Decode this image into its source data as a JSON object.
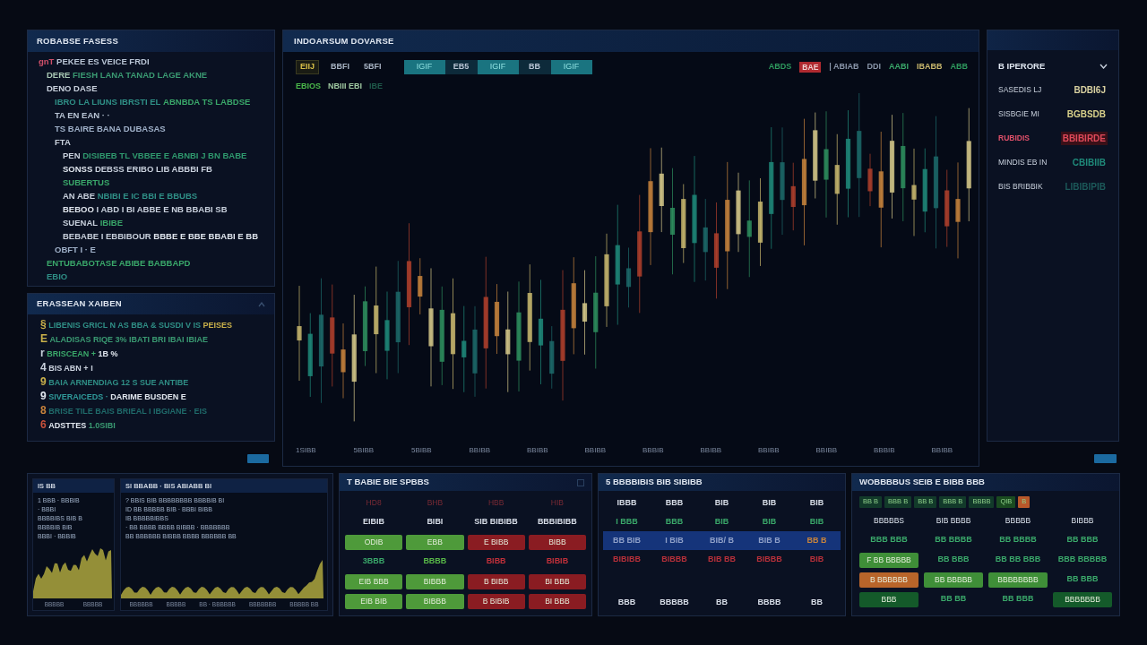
{
  "outline_panel": {
    "title": "ROBABSE FASESS",
    "lines": [
      {
        "segments": [
          {
            "text": "gnT",
            "color": "#d0506a"
          },
          {
            "text": "PEKEE ES VEICE FRDI",
            "color": "#b8c4d4"
          }
        ],
        "children": [
          {
            "segments": [
              {
                "text": "DERE",
                "color": "#a8c8b4"
              },
              {
                "text": "FIESH LANA TANAD LAGE AKNE",
                "color": "#3a9a72"
              }
            ]
          },
          {
            "segments": [
              {
                "text": "DENO DASE",
                "color": "#c8d0dc"
              }
            ],
            "children": [
              {
                "segments": [
                  {
                    "text": "IBRO LA LIUNS IBRSTI EL",
                    "color": "#2f8f86"
                  },
                  {
                    "text": "ABNBDA TS LABDSE",
                    "color": "#3aa86a"
                  }
                ]
              },
              {
                "segments": [
                  {
                    "text": "TA EN EAN · ·",
                    "color": "#b8c4d4"
                  }
                ]
              },
              {
                "segments": [
                  {
                    "text": "TS BAIRE BANA DUBASAS",
                    "color": "#9fb0c8"
                  }
                ]
              },
              {
                "segments": [
                  {
                    "text": "FTA",
                    "color": "#c8d0dc"
                  }
                ],
                "children": [
                  {
                    "segments": [
                      {
                        "text": "PEN",
                        "color": "#c8d0dc"
                      },
                      {
                        "text": "DISIBEB TL VBBEE E ABNBI J BN BABE",
                        "color": "#2f9a6e"
                      }
                    ]
                  },
                  {
                    "segments": [
                      {
                        "text": "SONSS",
                        "color": "#e0e6ee"
                      },
                      {
                        "text": "DEBSS ERIBO LIB ABBBI FB",
                        "color": "#c8d0dc"
                      }
                    ]
                  },
                  {
                    "segments": [
                      {
                        "text": "SUBERTUS",
                        "color": "#3aa86a"
                      }
                    ]
                  },
                  {
                    "segments": [
                      {
                        "text": "AN ABE",
                        "color": "#c8d0dc"
                      },
                      {
                        "text": "NBIBI E IC BBI E BBUBS",
                        "color": "#2f8f86"
                      }
                    ]
                  },
                  {
                    "segments": [
                      {
                        "text": "BEBOO",
                        "color": "#e0e6ee"
                      },
                      {
                        "text": "I ABD I BI ABBE E NB BBABI SB",
                        "color": "#c8d0dc"
                      }
                    ]
                  },
                  {
                    "segments": [
                      {
                        "text": "SUENAL",
                        "color": "#c8d0dc"
                      },
                      {
                        "text": "IBIBE",
                        "color": "#3aa86a"
                      }
                    ]
                  },
                  {
                    "segments": [
                      {
                        "text": "BEBABE I EBBIBOUR",
                        "color": "#c8d0dc"
                      },
                      {
                        "text": "BBBE E BBE BBABI E BB",
                        "color": "#e0e6ee"
                      }
                    ]
                  }
                ]
              },
              {
                "segments": [
                  {
                    "text": "OBFT I · E",
                    "color": "#9fb0c8"
                  }
                ]
              }
            ]
          },
          {
            "segments": [
              {
                "text": "ENTUBABOTASE ABIBE BABBAPD",
                "color": "#3aa86a"
              }
            ]
          },
          {
            "segments": [
              {
                "text": "EBIO",
                "color": "#2f8f86"
              }
            ]
          }
        ]
      }
    ]
  },
  "notes_panel": {
    "title": "ERASSEAN XAIBEN",
    "lines": [
      {
        "segments": [
          {
            "text": "§",
            "color": "#c9b04a"
          },
          {
            "text": "LIBENIS GRICL N AS BBA & SUSDI V IS",
            "color": "#2f8f86"
          },
          {
            "text": "PEISES",
            "color": "#c9b04a"
          }
        ]
      },
      {
        "segments": [
          {
            "text": "E",
            "color": "#c9b04a"
          },
          {
            "text": "ALADISAS RIQE 3% IBATI BRI IBAI IBIAE",
            "color": "#3a9a72"
          }
        ]
      },
      {
        "segments": [
          {
            "text": "r",
            "color": "#c8d0dc"
          },
          {
            "text": "BRISCEAN +",
            "color": "#3aa86a"
          },
          {
            "text": "1B %",
            "color": "#e0e6ee"
          }
        ]
      },
      {
        "segments": [
          {
            "text": "4",
            "color": "#c8d0dc"
          },
          {
            "text": "BIS ABN + I",
            "color": "#c8d0dc"
          }
        ]
      },
      {
        "segments": [
          {
            "text": "9",
            "color": "#c9b04a"
          },
          {
            "text": "BAIA ARNENDIAG 12 S SUE ANTIBE",
            "color": "#2f8f86"
          }
        ]
      },
      {
        "segments": [
          {
            "text": "9",
            "color": "#e0e6ee"
          },
          {
            "text": "SIVERAICEDS ·",
            "color": "#2f9a9a"
          },
          {
            "text": "DARIME BUSDEN E",
            "color": "#e0e6ee"
          }
        ]
      },
      {
        "segments": [
          {
            "text": "8",
            "color": "#c9843c"
          },
          {
            "text": "BRISE TILE BAIS BRIEAL I IBGIANE · EIS",
            "color": "#1f6a6a"
          }
        ]
      },
      {
        "segments": [
          {
            "text": "6",
            "color": "#c8503a"
          },
          {
            "text": "ADSTTES",
            "color": "#e0e6ee"
          },
          {
            "text": "1.0SIBI",
            "color": "#3a9a72"
          }
        ]
      }
    ]
  },
  "chart_panel": {
    "title": "INDOARSUM DOVARSE",
    "tools": [
      {
        "label": "EIIJ",
        "selected": true
      },
      {
        "label": "BBFI",
        "selected": false
      },
      {
        "label": "5BFI",
        "selected": false
      }
    ],
    "timeframes": [
      {
        "label": "IGIF",
        "selected": true
      },
      {
        "label": "EB5",
        "selected": false
      },
      {
        "label": "IGIF",
        "selected": true
      },
      {
        "label": "BB",
        "selected": false
      },
      {
        "label": "IGIF",
        "selected": true
      }
    ],
    "legend": [
      {
        "text": "ABDS",
        "color": "#2e9a5e",
        "kind": "text"
      },
      {
        "text": "BAE",
        "color": "#b02a30",
        "kind": "badge"
      },
      {
        "text": "| ABIAB",
        "color": "#8a96aa",
        "kind": "text"
      },
      {
        "text": "DDI",
        "color": "#8a96aa",
        "kind": "text"
      },
      {
        "text": "AABI",
        "color": "#3aa86a",
        "kind": "text"
      },
      {
        "text": "IBABB",
        "color": "#c9b86e",
        "kind": "text"
      },
      {
        "text": "ABB",
        "color": "#2e9a5e",
        "kind": "text"
      }
    ],
    "readouts": [
      {
        "text": "EBIOS",
        "color": "#4ab84a"
      },
      {
        "text": "NBIII EBI",
        "color": "#9fc8a0"
      },
      {
        "text": "IBE",
        "color": "#1f5a4a"
      }
    ],
    "x_labels": [
      "1SIBB",
      "5BIBB",
      "5BIBB",
      "BBIBB",
      "BBIBB",
      "BBIBB",
      "BBBIB",
      "BBIBB",
      "BBIBB",
      "BBIBB",
      "BBBIB",
      "BBIBB"
    ]
  },
  "watchlist": {
    "title": "B IPERORE",
    "rows": [
      {
        "name": "SASEDIS LJ",
        "value": "BDBI6J",
        "color": "#d8d0a0",
        "alert": false
      },
      {
        "name": "SISBGIE MI",
        "value": "BGBSDB",
        "color": "#d8d08a",
        "alert": false
      },
      {
        "name": "RUBIDIS",
        "value": "BBIBIRDE",
        "color": "#e04a5a",
        "alert": true
      },
      {
        "name": "MINDIS EB IN",
        "value": "CBIBIIB",
        "color": "#1f8a7a",
        "alert": false
      },
      {
        "name": "BIS BRIBBIK",
        "value": "LIBIBIPIB",
        "color": "#1c5a5a",
        "alert": false
      }
    ]
  },
  "mini_charts": [
    {
      "title": "IS BB",
      "lines": [
        "1 BBB · BBBIB",
        "· BBBI",
        "BBBBIBS BIB B",
        "BBBBIB BIB",
        "BBBI · BBBIB"
      ],
      "x_labels": [
        "BBBBB",
        "BBBBB"
      ]
    },
    {
      "title": "SI BBABB · BIS ABIABB BI",
      "lines": [
        "? BBIS BIB BBBBBBBB BBBBIB BI",
        "ID BB BBBBB BIB · BBBI BIBB",
        "IB BBBBBIBBS",
        "· BB BBBB BBBB BIBBB · BBBBBBB",
        "BB BBBBBB BIBBB BBBB BBBBBB BB"
      ],
      "x_labels": [
        "BBBBBB",
        "BBBBB",
        "BB · BBBBBB",
        "BBBBBBB",
        "BBBBB BB"
      ]
    }
  ],
  "quotes_table": {
    "title": "T BABIE BIE SPBBS",
    "header": [
      "HD8",
      "BHB",
      "HBB",
      "HIB"
    ],
    "rows": [
      [
        {
          "text": "EIBIB",
          "color": "#d8dee8",
          "kind": "text"
        },
        {
          "text": "BIBI",
          "color": "#d8dee8",
          "kind": "text"
        },
        {
          "text": "SIB BIBIBB",
          "color": "#d8dee8",
          "kind": "text"
        },
        {
          "text": "BBBIBIBB",
          "color": "#d8dee8",
          "kind": "text"
        }
      ],
      [
        {
          "text": "ODIB",
          "color": "#4e9a3a",
          "kind": "filled"
        },
        {
          "text": "EBB",
          "color": "#4e9a3a",
          "kind": "filled"
        },
        {
          "text": "E BIBB",
          "color": "#8a1c22",
          "kind": "filled"
        },
        {
          "text": "BIBB",
          "color": "#8a1c22",
          "kind": "filled"
        }
      ],
      [
        {
          "text": "3BBB",
          "color": "#3aa86a",
          "kind": "text"
        },
        {
          "text": "BBBB",
          "color": "#58b848",
          "kind": "text"
        },
        {
          "text": "BIBB",
          "color": "#c0303a",
          "kind": "text"
        },
        {
          "text": "BIBIB",
          "color": "#c0303a",
          "kind": "text"
        }
      ],
      [
        {
          "text": "EIB BBB",
          "color": "#4e9a3a",
          "kind": "filled"
        },
        {
          "text": "BIBBB",
          "color": "#4e9a3a",
          "kind": "filled"
        },
        {
          "text": "B BIBB",
          "color": "#8a1c22",
          "kind": "filled"
        },
        {
          "text": "BI BBB",
          "color": "#8a1c22",
          "kind": "filled"
        }
      ],
      [
        {
          "text": "EIB BIB",
          "color": "#4e9a3a",
          "kind": "filled"
        },
        {
          "text": "BIBBB",
          "color": "#4e9a3a",
          "kind": "filled"
        },
        {
          "text": "B BIBIB",
          "color": "#8a1c22",
          "kind": "filled"
        },
        {
          "text": "BI BBB",
          "color": "#8a1c22",
          "kind": "filled"
        }
      ]
    ]
  },
  "trades_table": {
    "title": "5 BBBBIBIS BIB SIBIBB",
    "rows": [
      {
        "selected": false,
        "cells": [
          {
            "text": "IBBB",
            "color": "#d8dee8"
          },
          {
            "text": "BBB",
            "color": "#d8dee8"
          },
          {
            "text": "BIB",
            "color": "#d8dee8"
          },
          {
            "text": "BIB",
            "color": "#d8dee8"
          },
          {
            "text": "BIB",
            "color": "#d8dee8"
          }
        ]
      },
      {
        "selected": false,
        "cells": [
          {
            "text": "I BBB",
            "color": "#3aa86a"
          },
          {
            "text": "BBB",
            "color": "#3aa86a"
          },
          {
            "text": "BIB",
            "color": "#3aa86a"
          },
          {
            "text": "BIB",
            "color": "#3aa86a"
          },
          {
            "text": "BIB",
            "color": "#3aa86a"
          }
        ]
      },
      {
        "selected": true,
        "cells": [
          {
            "text": "BB BIB",
            "color": "#8fa0c8"
          },
          {
            "text": "I BIB",
            "color": "#8fa0c8"
          },
          {
            "text": "BIB/ B",
            "color": "#8fa0c8"
          },
          {
            "text": "BIB B",
            "color": "#8fa0c8"
          },
          {
            "text": "BB B",
            "color": "#c8843c"
          }
        ]
      },
      {
        "selected": false,
        "cells": [
          {
            "text": "BIBIBB",
            "color": "#b8303a"
          },
          {
            "text": "BIBBB",
            "color": "#b8303a"
          },
          {
            "text": "BIB BB",
            "color": "#b8303a"
          },
          {
            "text": "BIBBB",
            "color": "#b8303a"
          },
          {
            "text": "BIB",
            "color": "#b8303a"
          }
        ]
      },
      {
        "selected": false,
        "cells": [
          {
            "text": "BBB",
            "color": "#d8dee8"
          },
          {
            "text": "BBBBB",
            "color": "#d8dee8"
          },
          {
            "text": "BB",
            "color": "#d8dee8"
          },
          {
            "text": "BBBB",
            "color": "#d8dee8"
          },
          {
            "text": "BB",
            "color": "#d8dee8"
          }
        ]
      }
    ]
  },
  "orders_table": {
    "title": "WOBBBBUS SEIB E BIBB BBB",
    "chips": [
      {
        "text": "BB B",
        "color": "#123a2a"
      },
      {
        "text": "BBB B",
        "color": "#123a2a"
      },
      {
        "text": "BB B",
        "color": "#123a2a"
      },
      {
        "text": "BBB B",
        "color": "#123a2a"
      },
      {
        "text": "BBBB",
        "color": "#123a2a"
      },
      {
        "text": "QIB",
        "color": "#1a4a20"
      },
      {
        "text": "B",
        "color": "#b8582a"
      }
    ],
    "header": [
      "BBBBBS",
      "BIB BBBB",
      "BBBBB",
      "BIBBB"
    ],
    "rows": [
      [
        {
          "text": "BBB BBB",
          "color": "#3aa86a",
          "kind": "text"
        },
        {
          "text": "BB BBBB",
          "color": "#3aa86a",
          "kind": "text"
        },
        {
          "text": "BB BBBB",
          "color": "#3aa86a",
          "kind": "text"
        },
        {
          "text": "BB BBB",
          "color": "#3aa86a",
          "kind": "text"
        }
      ],
      [
        {
          "text": "F BB BBBBB",
          "color": "#3f8f38",
          "kind": "filled"
        },
        {
          "text": "BB BBB",
          "color": "#3aa86a",
          "kind": "text"
        },
        {
          "text": "BB BB BBB",
          "color": "#3aa86a",
          "kind": "text"
        },
        {
          "text": "BBB BBBBB",
          "color": "#3aa86a",
          "kind": "text"
        }
      ],
      [
        {
          "text": "B BBBBBB",
          "color": "#b8652a",
          "kind": "filled"
        },
        {
          "text": "BB BBBBB",
          "color": "#3f8f38",
          "kind": "filled"
        },
        {
          "text": "BBBBBBBB",
          "color": "#3f8f38",
          "kind": "filled"
        },
        {
          "text": "BB BBB",
          "color": "#3aa86a",
          "kind": "text"
        }
      ],
      [
        {
          "text": "BBB",
          "color": "#145a2a",
          "kind": "filled"
        },
        {
          "text": "BB BB",
          "color": "#3aa86a",
          "kind": "text"
        },
        {
          "text": "BB BBB",
          "color": "#3aa86a",
          "kind": "text"
        },
        {
          "text": "BBBBBBB",
          "color": "#145a2a",
          "kind": "filled"
        }
      ]
    ]
  }
}
